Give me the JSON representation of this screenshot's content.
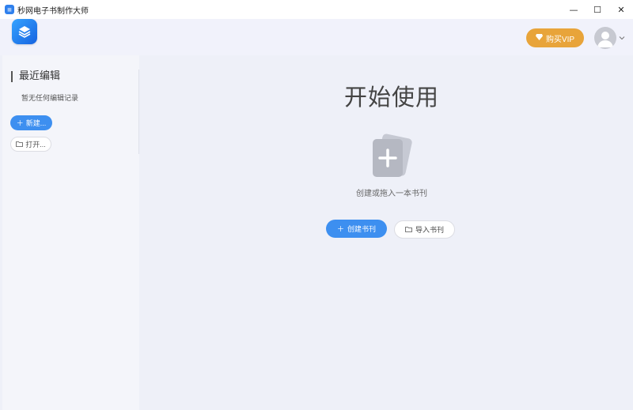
{
  "window": {
    "title": "秒网电子书制作大师",
    "controls": {
      "minimize": "—",
      "maximize": "☐",
      "close": "✕"
    }
  },
  "header": {
    "vip_label": "购买VIP"
  },
  "sidebar": {
    "section_title": "最近编辑",
    "empty_note": "暂无任何编辑记录",
    "new_label": "新建...",
    "open_label": "打开..."
  },
  "main": {
    "title": "开始使用",
    "drop_text": "创建或拖入一本书刊",
    "create_label": "创建书刊",
    "import_label": "导入书刊"
  },
  "colors": {
    "primary": "#3d8ff0",
    "vip": "#e8a43a",
    "background": "#eef0f8"
  },
  "icons": [
    "app-icon",
    "logo-icon",
    "diamond-icon",
    "avatar-user-icon",
    "chevron-down-icon",
    "plus-icon",
    "folder-icon",
    "add-book-icon"
  ]
}
